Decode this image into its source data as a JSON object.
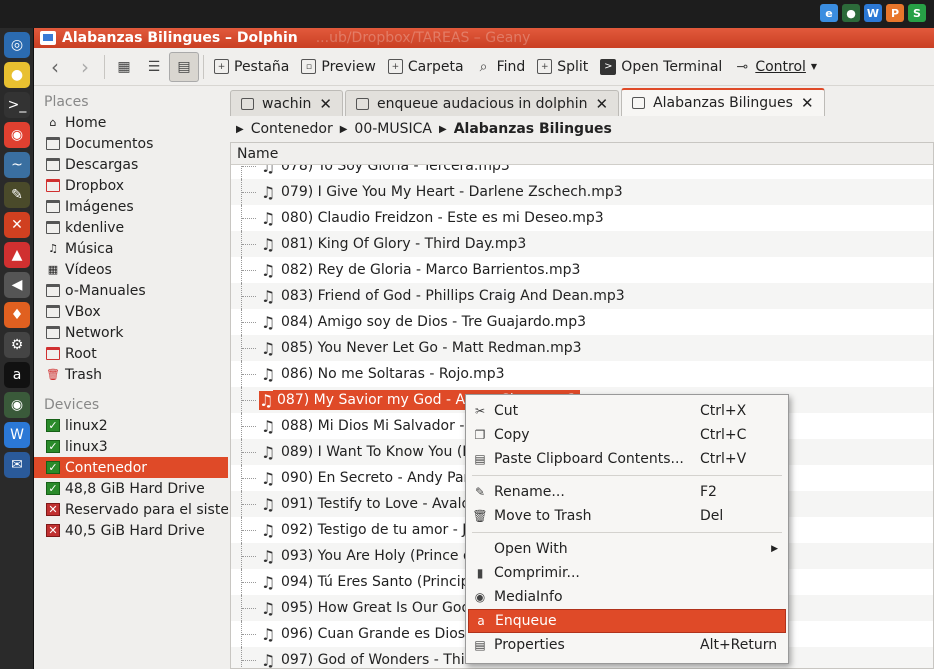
{
  "window": {
    "title": "Alabanzas Bilingues – Dolphin",
    "ghost_title": "...ub/Dropbox/TAREAS – Geany"
  },
  "tray": [
    "W",
    "P",
    "S"
  ],
  "toolbar": {
    "back": "back",
    "forward": "forward",
    "tab": "Pestaña",
    "preview": "Preview",
    "folder": "Carpeta",
    "find": "Find",
    "split": "Split",
    "terminal": "Open Terminal",
    "control": "Control"
  },
  "sidebar": {
    "places_title": "Places",
    "places": [
      "Home",
      "Documentos",
      "Descargas",
      "Dropbox",
      "Imágenes",
      "kdenlive",
      "Música",
      "Vídeos",
      "o-Manuales",
      "VBox",
      "Network",
      "Root",
      "Trash"
    ],
    "devices_title": "Devices",
    "devices": [
      "linux2",
      "linux3",
      "Contenedor",
      "48,8 GiB Hard Drive",
      "Reservado para el sistema",
      "40,5 GiB Hard Drive"
    ]
  },
  "tabs": [
    {
      "label": "wachin"
    },
    {
      "label": "enqueue audacious in dolphin"
    },
    {
      "label": "Alabanzas Bilingues"
    }
  ],
  "breadcrumb": [
    "Contenedor",
    "00-MUSICA",
    "Alabanzas Bilingues"
  ],
  "filelist": {
    "column": "Name",
    "partial_row": "078) Yo Soy Gloria - Tercera.mp3",
    "rows": [
      "079) I Give You My Heart - Darlene Zschech.mp3",
      "080) Claudio Freidzon - Este es mi Deseo.mp3",
      "081) King Of Glory - Third Day.mp3",
      "082) Rey de Gloria - Marco Barrientos.mp3",
      "083) Friend of God - Phillips Craig And Dean.mp3",
      "084) Amigo soy de Dios - Tre Guajardo.mp3",
      "085) You Never Let Go - Matt Redman.mp3",
      "086) No me Soltaras - Rojo.mp3",
      "087) My Savior my God - Aaron Shust.mp3",
      "088) Mi Dios Mi Salvador - S",
      "089) I Want To Know You (In",
      "090) En Secreto - Andy Park",
      "091) Testify to Love - Avalo",
      "092) Testigo de tu amor - Jo",
      "093) You Are Holy (Prince o",
      "094) Tú Eres Santo (Princip",
      "095) How Great Is Our God",
      "096) Cuan Grande es Dios -",
      "097) God of Wonders - Thir"
    ],
    "selected_index": 8
  },
  "context_menu": {
    "items": [
      {
        "label": "Cut",
        "shortcut": "Ctrl+X",
        "icon": "scissors-icon"
      },
      {
        "label": "Copy",
        "shortcut": "Ctrl+C",
        "icon": "copy-icon"
      },
      {
        "label": "Paste Clipboard Contents...",
        "shortcut": "Ctrl+V",
        "icon": "paste-icon"
      },
      {
        "label": "Rename...",
        "shortcut": "F2",
        "icon": "rename-icon"
      },
      {
        "label": "Move to Trash",
        "shortcut": "Del",
        "icon": "trash-icon"
      },
      {
        "label": "Open With",
        "shortcut": "",
        "icon": ""
      },
      {
        "label": "Comprimir...",
        "shortcut": "",
        "icon": "compress-icon"
      },
      {
        "label": "MediaInfo",
        "shortcut": "",
        "icon": "mediainfo-icon"
      },
      {
        "label": "Enqueue",
        "shortcut": "",
        "icon": "audacious-icon"
      },
      {
        "label": "Properties",
        "shortcut": "Alt+Return",
        "icon": "properties-icon"
      }
    ]
  },
  "colors": {
    "accent": "#df4a28",
    "titlebar": "#d04a2b"
  }
}
